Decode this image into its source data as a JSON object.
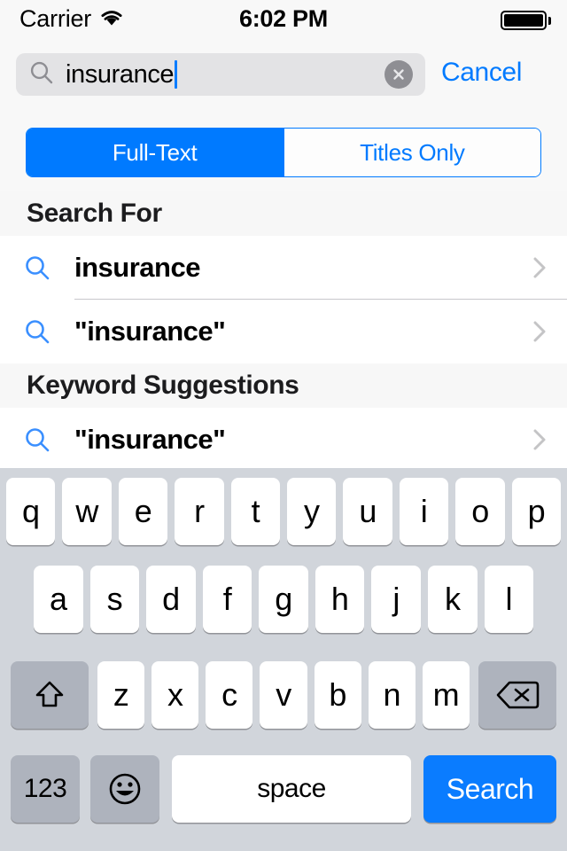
{
  "status_bar": {
    "carrier": "Carrier",
    "wifi_icon": "wifi-icon",
    "time": "6:02 PM",
    "battery_icon": "battery-full-icon"
  },
  "search": {
    "magnifier_icon": "search-icon",
    "value": "insurance",
    "placeholder": "Search",
    "clear_icon": "clear-circle-icon",
    "cancel_label": "Cancel"
  },
  "scope_bar": {
    "options": [
      {
        "label": "Full-Text",
        "selected": true
      },
      {
        "label": "Titles Only",
        "selected": false
      }
    ]
  },
  "sections": [
    {
      "header": "Search For",
      "rows": [
        {
          "icon": "search-icon",
          "label": "insurance",
          "accessory": "chevron-right-icon"
        },
        {
          "icon": "search-icon",
          "label": "\"insurance\"",
          "accessory": "chevron-right-icon"
        }
      ]
    },
    {
      "header": "Keyword Suggestions",
      "rows": [
        {
          "icon": "search-icon",
          "label": "\"insurance\"",
          "accessory": "chevron-right-icon"
        }
      ]
    }
  ],
  "keyboard": {
    "row1": [
      "q",
      "w",
      "e",
      "r",
      "t",
      "y",
      "u",
      "i",
      "o",
      "p"
    ],
    "row2": [
      "a",
      "s",
      "d",
      "f",
      "g",
      "h",
      "j",
      "k",
      "l"
    ],
    "row3": [
      "z",
      "x",
      "c",
      "v",
      "b",
      "n",
      "m"
    ],
    "shift_icon": "shift-icon",
    "backspace_icon": "backspace-icon",
    "numbers_label": "123",
    "emoji_icon": "emoji-icon",
    "space_label": "space",
    "return_label": "Search"
  },
  "colors": {
    "accent": "#007aff",
    "key_blue": "#0a7cff",
    "keyboard_bg": "#d1d5db",
    "gray_key": "#aeb3bd",
    "field_bg": "#e3e3e5",
    "section_bg": "#f7f7f7",
    "separator": "#c8c7cc"
  }
}
